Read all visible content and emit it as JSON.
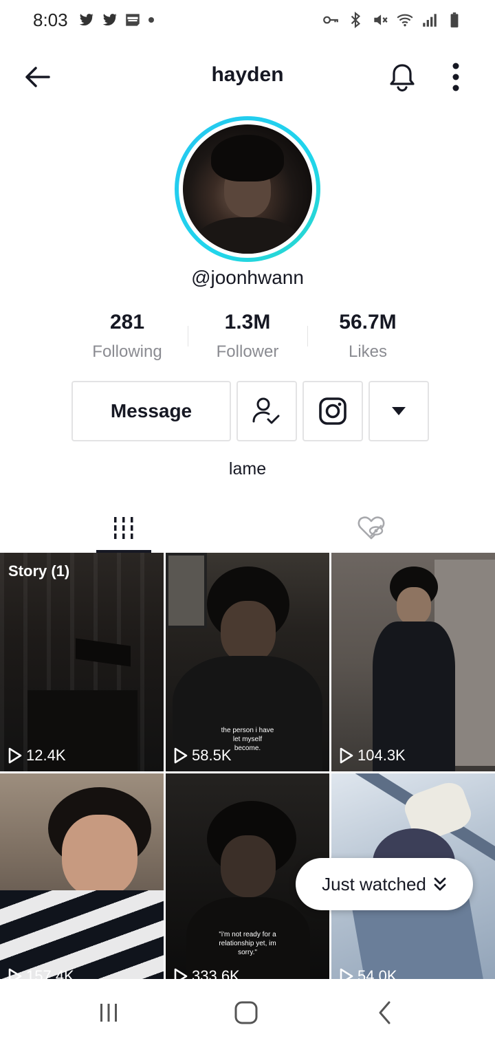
{
  "status_bar": {
    "time": "8:03",
    "left_icons": [
      "twitter-icon",
      "twitter-icon",
      "webtoon-icon",
      "dot-icon"
    ],
    "right_icons": [
      "vpn-key-icon",
      "bluetooth-icon",
      "mute-icon",
      "wifi-icon",
      "signal-icon",
      "battery-icon"
    ]
  },
  "header": {
    "title": "hayden",
    "back_icon": "arrow-left-icon",
    "bell_icon": "bell-icon",
    "more_icon": "more-vertical-icon"
  },
  "profile": {
    "username": "@joonhwann",
    "bio": "lame",
    "ring_color": "#20d5ec"
  },
  "stats": [
    {
      "value": "281",
      "label": "Following"
    },
    {
      "value": "1.3M",
      "label": "Follower"
    },
    {
      "value": "56.7M",
      "label": "Likes"
    }
  ],
  "actions": {
    "message_label": "Message",
    "following_icon": "user-check-icon",
    "instagram_icon": "instagram-icon",
    "dropdown_icon": "caret-down-icon"
  },
  "tabs": [
    {
      "icon": "grid-icon",
      "active": true
    },
    {
      "icon": "heart-hidden-icon",
      "active": false
    }
  ],
  "videos": [
    {
      "views": "12.4K",
      "tag": "Story (1)",
      "caption": ""
    },
    {
      "views": "58.5K",
      "tag": "",
      "caption": "the person i have let myself become."
    },
    {
      "views": "104.3K",
      "tag": "",
      "caption": ""
    },
    {
      "views": "157.4K",
      "tag": "",
      "caption": ""
    },
    {
      "views": "333.6K",
      "tag": "",
      "caption": "\"i'm not ready for a relationship yet, im sorry.\""
    },
    {
      "views": "54.0K",
      "tag": "",
      "caption": ""
    }
  ],
  "just_watched": {
    "label": "Just watched",
    "icon": "double-chevron-down-icon"
  },
  "navbar": {
    "icons": [
      "recents-icon",
      "home-icon",
      "back-icon"
    ]
  }
}
